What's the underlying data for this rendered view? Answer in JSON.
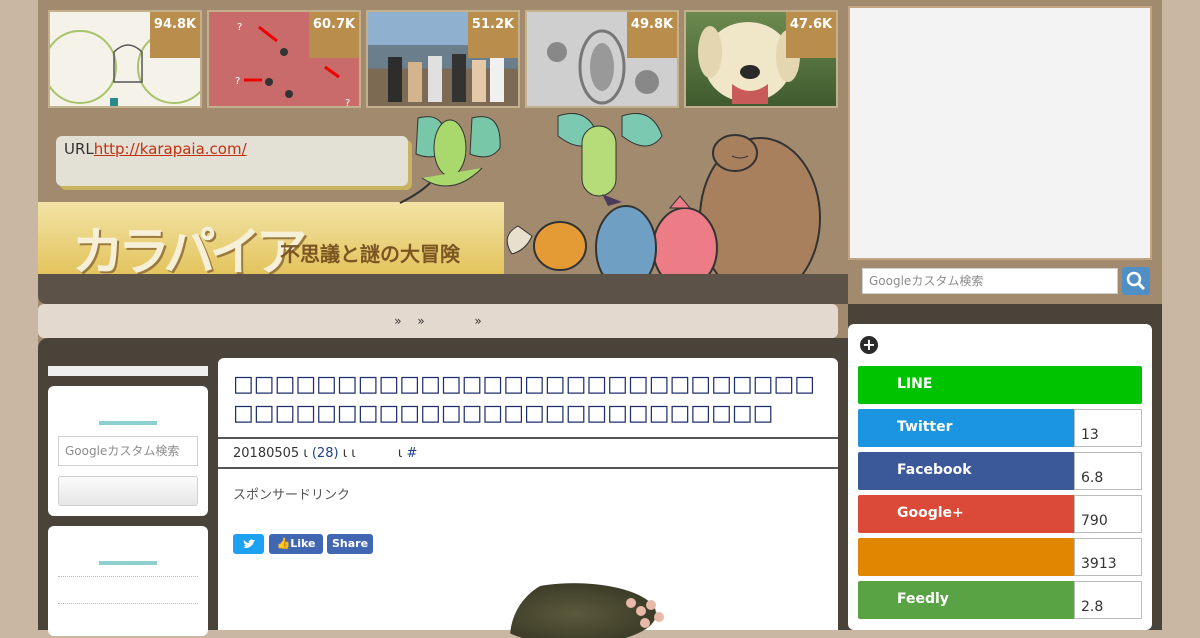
{
  "popular": [
    {
      "count": "94.8K"
    },
    {
      "count": "60.7K"
    },
    {
      "count": "51.2K"
    },
    {
      "count": "49.8K"
    },
    {
      "count": "47.6K"
    }
  ],
  "site": {
    "url_label": "URL",
    "url": "http://karapaia.com/",
    "logo": "カラパイア",
    "tagline": "不思議と謎の大冒険"
  },
  "search": {
    "placeholder": "Googleカスタム検索"
  },
  "breadcrumb": {
    "sep1": "»",
    "sep2": "»",
    "sep3": "»"
  },
  "article": {
    "title": "□□□□□□□□□□□□□□□□□□□□□□□□□□□□□□□□□□□□□□□□□□□□□□□□□□□□□□",
    "date": "20180505",
    "comments": "(28)",
    "hash": "#",
    "sponsor": "スポンサードリンク"
  },
  "social_small": {
    "twitter": "",
    "like": "Like",
    "share": "Share"
  },
  "share": [
    {
      "name": "LINE",
      "count": "",
      "color": "#00c300"
    },
    {
      "name": "Twitter",
      "count": "13",
      "color": "#1b95e0"
    },
    {
      "name": "Facebook",
      "count": "6.8",
      "color": "#3b5998"
    },
    {
      "name": "Google+",
      "count": "790",
      "color": "#db4a39"
    },
    {
      "name": "",
      "count": "3913",
      "color": "#e08600"
    },
    {
      "name": "Feedly",
      "count": "2.8",
      "color": "#6cc655"
    }
  ]
}
